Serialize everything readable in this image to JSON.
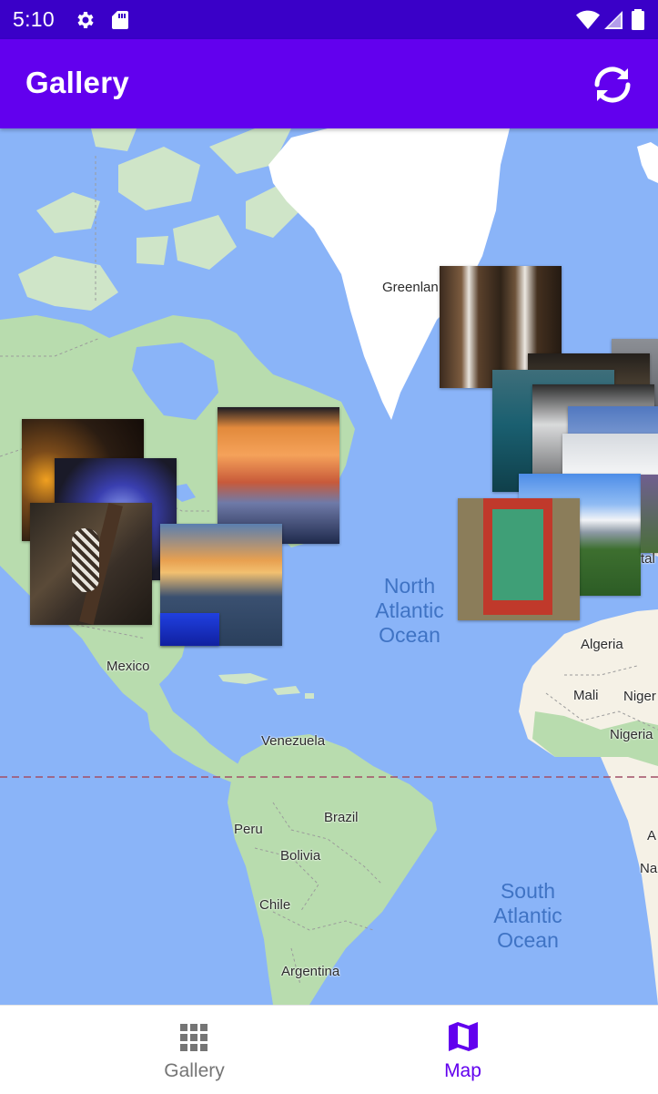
{
  "status_bar": {
    "time": "5:10",
    "icons": [
      "gear-icon",
      "sd-card-icon",
      "wifi-icon",
      "signal-icon",
      "battery-icon"
    ]
  },
  "app_bar": {
    "title": "Gallery",
    "action_icon": "refresh-icon"
  },
  "map": {
    "place_labels": {
      "greenland": "Greenlan",
      "mexico": "Mexico",
      "venezuela": "Venezuela",
      "brazil": "Brazil",
      "peru": "Peru",
      "bolivia": "Bolivia",
      "chile": "Chile",
      "argentina": "Argentina",
      "algeria": "Algeria",
      "mali": "Mali",
      "niger": "Niger",
      "nigeria": "Nigeria",
      "edge_tal": "tal",
      "edge_na": "Na",
      "edge_a": "A"
    },
    "ocean_labels": {
      "north_atlantic": "North\nAtlantic\nOcean",
      "south_atlantic": "South\nAtlantic\nOcean"
    },
    "photo_markers": [
      "waterfall-photo",
      "sunset-lake-photo",
      "dark-fire-photo",
      "iris-flower-photo",
      "woodpecker-photo",
      "sea-sunset-photo",
      "blue-photo",
      "coast-photo",
      "mist-photo",
      "snow-mountain-photo",
      "green-window-photo"
    ]
  },
  "bottom_nav": {
    "items": [
      {
        "label": "Gallery",
        "icon": "grid-icon",
        "selected": false
      },
      {
        "label": "Map",
        "icon": "map-icon",
        "selected": true
      }
    ]
  },
  "colors": {
    "status_bar": "#3a00c8",
    "app_bar": "#6200ee",
    "selected_nav": "#6200ee",
    "unselected_nav": "#757575",
    "ocean": "#8ab4f8"
  }
}
